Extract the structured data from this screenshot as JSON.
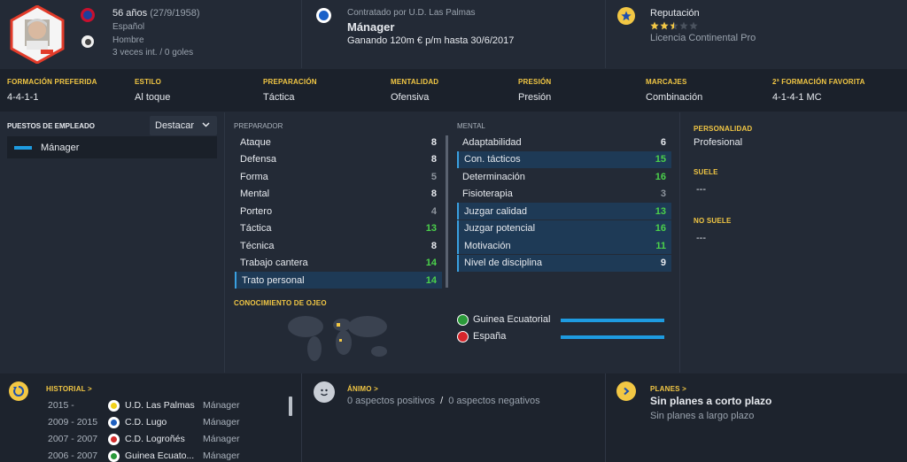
{
  "header": {
    "age_label": "56 años",
    "dob": "(27/9/1958)",
    "nationality": "Español",
    "gender": "Hombre",
    "caps": "3 veces int. / 0 goles",
    "contract_label": "Contratado por U.D. Las Palmas",
    "role": "Mánager",
    "wage": "Ganando 120m € p/m hasta 30/6/2017",
    "reputation_label": "Reputación",
    "reputation_stars": 2.5,
    "license": "Licencia Continental Pro"
  },
  "attributes": [
    {
      "label": "FORMACIÓN PREFERIDA",
      "value": "4-4-1-1"
    },
    {
      "label": "ESTILO",
      "value": "Al toque"
    },
    {
      "label": "PREPARACIÓN",
      "value": "Táctica"
    },
    {
      "label": "MENTALIDAD",
      "value": "Ofensiva"
    },
    {
      "label": "PRESIÓN",
      "value": "Presión"
    },
    {
      "label": "MARCAJES",
      "value": "Combinación"
    },
    {
      "label": "2ª FORMACIÓN FAVORITA",
      "value": "4-1-4-1 MC"
    }
  ],
  "jobs": {
    "title": "PUESTOS DE EMPLEADO",
    "dropdown": "Destacar",
    "items": [
      "Mánager"
    ]
  },
  "preparador": {
    "title": "PREPARADOR",
    "rows": [
      {
        "label": "Ataque",
        "value": "8",
        "tone": "white",
        "hl": false
      },
      {
        "label": "Defensa",
        "value": "8",
        "tone": "white",
        "hl": false
      },
      {
        "label": "Forma",
        "value": "5",
        "tone": "gray",
        "hl": false
      },
      {
        "label": "Mental",
        "value": "8",
        "tone": "white",
        "hl": false
      },
      {
        "label": "Portero",
        "value": "4",
        "tone": "gray",
        "hl": false
      },
      {
        "label": "Táctica",
        "value": "13",
        "tone": "green",
        "hl": false
      },
      {
        "label": "Técnica",
        "value": "8",
        "tone": "white",
        "hl": false
      },
      {
        "label": "Trabajo cantera",
        "value": "14",
        "tone": "green",
        "hl": false
      },
      {
        "label": "Trato personal",
        "value": "14",
        "tone": "green",
        "hl": true
      }
    ]
  },
  "mental": {
    "title": "MENTAL",
    "rows": [
      {
        "label": "Adaptabilidad",
        "value": "6",
        "tone": "white",
        "hl": false
      },
      {
        "label": "Con. tácticos",
        "value": "15",
        "tone": "green",
        "hl": true
      },
      {
        "label": "Determinación",
        "value": "16",
        "tone": "green",
        "hl": false
      },
      {
        "label": "Fisioterapia",
        "value": "3",
        "tone": "gray",
        "hl": false
      },
      {
        "label": "Juzgar calidad",
        "value": "13",
        "tone": "green",
        "hl": true
      },
      {
        "label": "Juzgar potencial",
        "value": "16",
        "tone": "green",
        "hl": true
      },
      {
        "label": "Motivación",
        "value": "11",
        "tone": "green",
        "hl": true
      },
      {
        "label": "Nivel de disciplina",
        "value": "9",
        "tone": "white",
        "hl": true
      }
    ]
  },
  "personality": {
    "personalidad_label": "PERSONALIDAD",
    "personalidad_value": "Profesional",
    "suele_label": "SUELE",
    "suele_value": "---",
    "no_suele_label": "NO SUELE",
    "no_suele_value": "---"
  },
  "scouting": {
    "title": "CONOCIMIENTO DE OJEO",
    "countries": [
      {
        "name": "Guinea Ecuatorial",
        "knowledge": 1.0
      },
      {
        "name": "España",
        "knowledge": 1.0
      }
    ]
  },
  "history": {
    "title": "HISTORIAL >",
    "rows": [
      {
        "years": "2015 -",
        "club": "U.D. Las Palmas",
        "role": "Mánager"
      },
      {
        "years": "2009 - 2015",
        "club": "C.D. Lugo",
        "role": "Mánager"
      },
      {
        "years": "2007 - 2007",
        "club": "C.D. Logroñés",
        "role": "Mánager"
      },
      {
        "years": "2006 - 2007",
        "club": "Guinea Ecuato...",
        "role": "Mánager"
      }
    ]
  },
  "mood": {
    "title": "ÁNIMO >",
    "positive": "0 aspectos positivos",
    "sep": "/",
    "negative": "0 aspectos negativos"
  },
  "plans": {
    "title": "PLANES >",
    "short": "Sin planes a corto plazo",
    "long": "Sin planes a largo plazo"
  },
  "colors": {
    "accent_yellow": "#f2c744",
    "accent_blue": "#1e9be0",
    "highlight_row": "#1e3a56",
    "green_value": "#4bd14b"
  }
}
